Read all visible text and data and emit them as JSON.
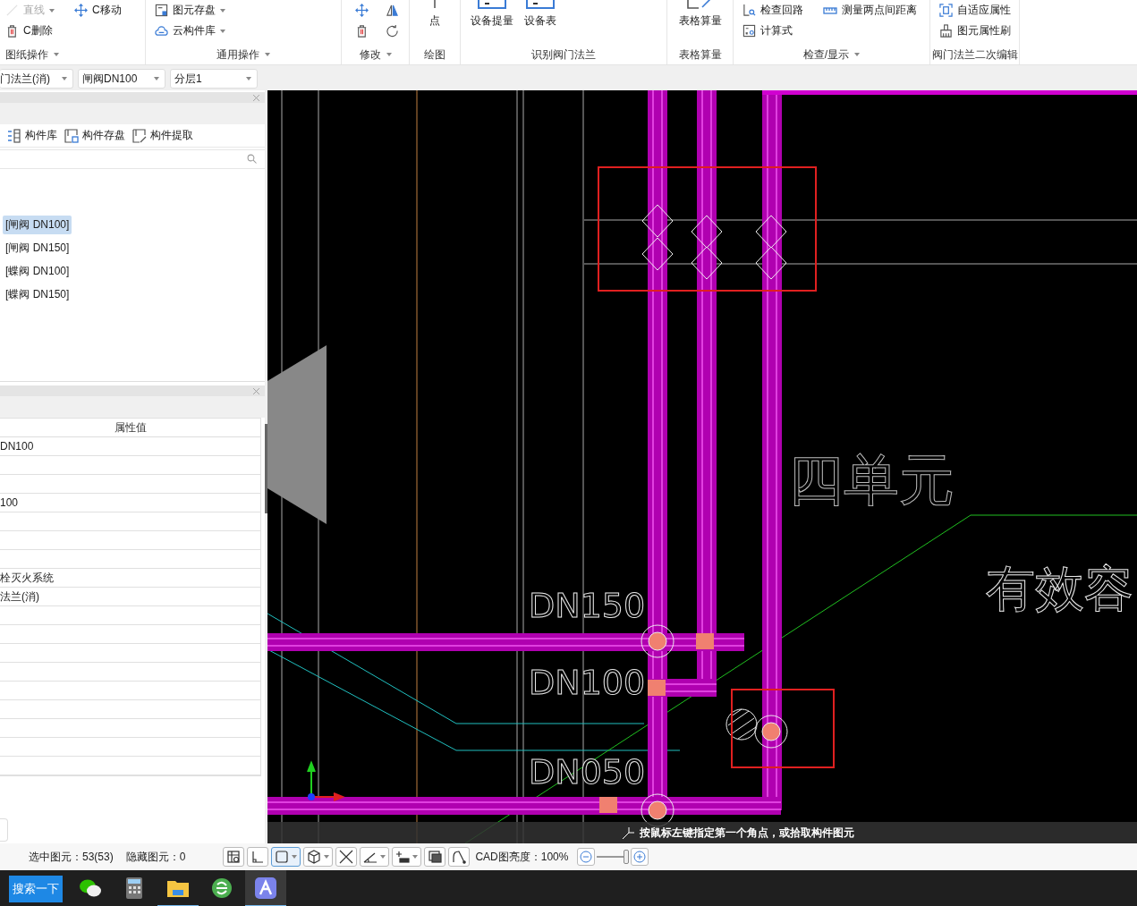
{
  "ribbon": {
    "groups": [
      {
        "label": "图纸操作",
        "menu": true,
        "items": [
          {
            "kind": "small",
            "label": "直线",
            "disabled": true,
            "menu": true
          },
          {
            "kind": "small",
            "label": "C删除",
            "disabled": false,
            "menu": false
          },
          {
            "kind": "small",
            "label": "C移动",
            "disabled": false,
            "menu": false
          }
        ]
      },
      {
        "label": "通用操作",
        "menu": true,
        "items": [
          {
            "kind": "small",
            "label": "图元存盘",
            "disabled": false,
            "menu": true
          },
          {
            "kind": "small",
            "label": "云构件库",
            "disabled": false,
            "menu": true
          }
        ]
      },
      {
        "label": "修改",
        "menu": true,
        "items": [
          {
            "kind": "icon",
            "disabled": false,
            "menu": false
          },
          {
            "kind": "icon",
            "disabled": false,
            "menu": false
          },
          {
            "kind": "icon",
            "disabled": false,
            "menu": false
          },
          {
            "kind": "icon",
            "disabled": false,
            "menu": false
          }
        ]
      },
      {
        "label": "绘图",
        "menu": false,
        "items": [
          {
            "kind": "large",
            "label": "点",
            "disabled": false,
            "menu": false
          }
        ]
      },
      {
        "label": "识别阀门法兰",
        "menu": false,
        "items": [
          {
            "kind": "large",
            "label": "设备提量",
            "disabled": false,
            "menu": false
          },
          {
            "kind": "large",
            "label": "设备表",
            "disabled": false,
            "menu": false
          }
        ]
      },
      {
        "label": "表格算量",
        "menu": false,
        "items": [
          {
            "kind": "large",
            "label": "表格算量",
            "disabled": false,
            "menu": false
          }
        ]
      },
      {
        "label": "检查/显示",
        "menu": true,
        "items": [
          {
            "kind": "small",
            "label": "检查回路",
            "disabled": false,
            "menu": false
          },
          {
            "kind": "small",
            "label": "计算式",
            "disabled": false,
            "menu": false
          },
          {
            "kind": "small",
            "label": "测量两点间距离",
            "disabled": false,
            "menu": false
          }
        ]
      },
      {
        "label": "阀门法兰二次编辑",
        "menu": false,
        "items": [
          {
            "kind": "small",
            "label": "自适应属性",
            "disabled": false,
            "menu": false
          },
          {
            "kind": "small",
            "label": "图元属性刷",
            "disabled": false,
            "menu": false
          }
        ]
      }
    ]
  },
  "selectors": [
    {
      "value": "门法兰(消)"
    },
    {
      "value": "闸阀DN100"
    },
    {
      "value": "分层1"
    }
  ],
  "component_panel": {
    "toolbar": [
      {
        "label": "构件库"
      },
      {
        "label": "构件存盘"
      },
      {
        "label": "构件提取"
      }
    ],
    "tree": [
      {
        "label": "[闸阀 DN100]",
        "selected": true
      },
      {
        "label": "[闸阀 DN150]",
        "selected": false
      },
      {
        "label": "[蝶阀 DN100]",
        "selected": false
      },
      {
        "label": "[蝶阀 DN150]",
        "selected": false
      }
    ]
  },
  "property_panel": {
    "column": "属性值",
    "rows": [
      {
        "value": "DN100"
      },
      {},
      {},
      {
        "value": "100"
      },
      {},
      {},
      {},
      {
        "value": "栓灭火系统"
      },
      {
        "value": "法兰(消)"
      },
      {},
      {},
      {},
      {},
      {},
      {},
      {},
      {},
      {}
    ]
  },
  "canvas": {
    "texts": [
      {
        "text": "DN150"
      },
      {
        "text": "DN100"
      },
      {
        "text": "DN050"
      },
      {
        "text": "四单元"
      },
      {
        "text": "有效容"
      }
    ],
    "prompt": "按鼠标左键指定第一个角点，或拾取构件图元"
  },
  "status_bar": {
    "selected_count": "选中图元：53(53)",
    "hidden_count": "隐藏图元：0",
    "tools": [
      {
        "menu": false,
        "selected": false
      },
      {
        "menu": false,
        "selected": false
      },
      {
        "menu": true,
        "selected": true
      },
      {
        "menu": true,
        "selected": false
      },
      {
        "menu": false,
        "selected": false
      },
      {
        "menu": true,
        "selected": false
      },
      {
        "menu": true,
        "selected": false
      },
      {
        "menu": false,
        "selected": false
      },
      {
        "menu": false,
        "selected": false
      }
    ],
    "brightness_label": "CAD图亮度：100%",
    "brightness": {
      "level": 1
    }
  },
  "taskbar": {
    "search_button": "搜索一下",
    "apps": [
      {
        "running": false,
        "selected": false
      },
      {
        "running": false,
        "selected": false
      },
      {
        "running": true,
        "selected": false
      },
      {
        "running": false,
        "selected": false
      },
      {
        "running": true,
        "selected": true
      }
    ]
  }
}
